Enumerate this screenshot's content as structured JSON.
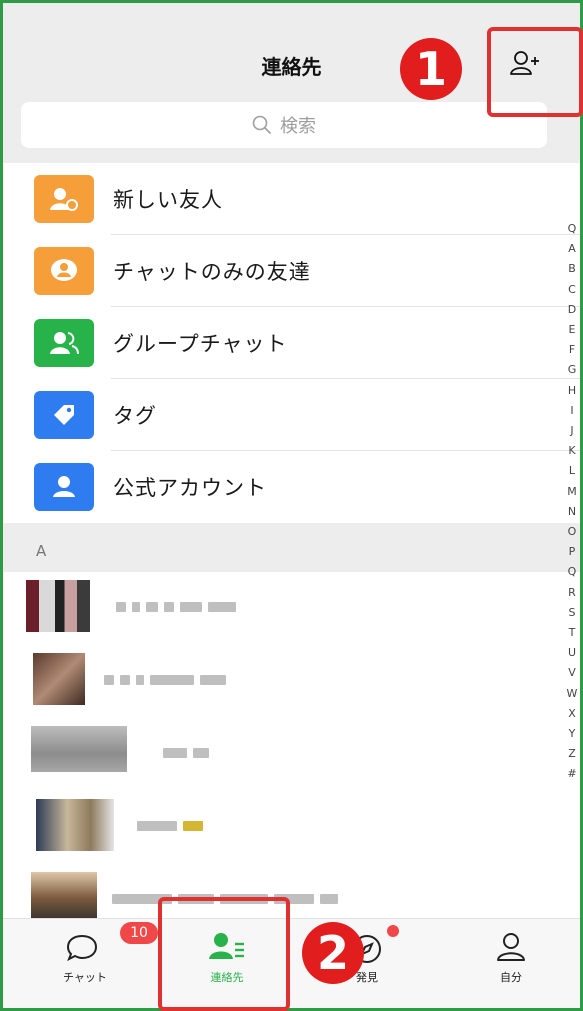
{
  "header": {
    "title": "連絡先"
  },
  "search": {
    "placeholder": "検索"
  },
  "menu": [
    {
      "label": "新しい友人",
      "icon": "new-friend-icon",
      "color": "#f59e3a"
    },
    {
      "label": "チャットのみの友達",
      "icon": "chat-only-friend-icon",
      "color": "#f59e3a"
    },
    {
      "label": "グループチャット",
      "icon": "group-chat-icon",
      "color": "#27b24a"
    },
    {
      "label": "タグ",
      "icon": "tag-icon",
      "color": "#2f7bf0"
    },
    {
      "label": "公式アカウント",
      "icon": "official-account-icon",
      "color": "#2f7bf0"
    }
  ],
  "section_letter": "A",
  "index_letters": [
    "Q",
    "A",
    "B",
    "C",
    "D",
    "E",
    "F",
    "G",
    "H",
    "I",
    "J",
    "K",
    "L",
    "M",
    "N",
    "O",
    "P",
    "Q",
    "R",
    "S",
    "T",
    "U",
    "V",
    "W",
    "X",
    "Y",
    "Z",
    "#"
  ],
  "tabs": [
    {
      "label": "チャット",
      "badge": "10"
    },
    {
      "label": "連絡先"
    },
    {
      "label": "発見"
    },
    {
      "label": "自分"
    }
  ],
  "annotations": {
    "step1": "1",
    "step2": "2"
  },
  "colors": {
    "accent": "#27b24a",
    "highlight": "#e03030",
    "frame": "#2f9b47"
  }
}
